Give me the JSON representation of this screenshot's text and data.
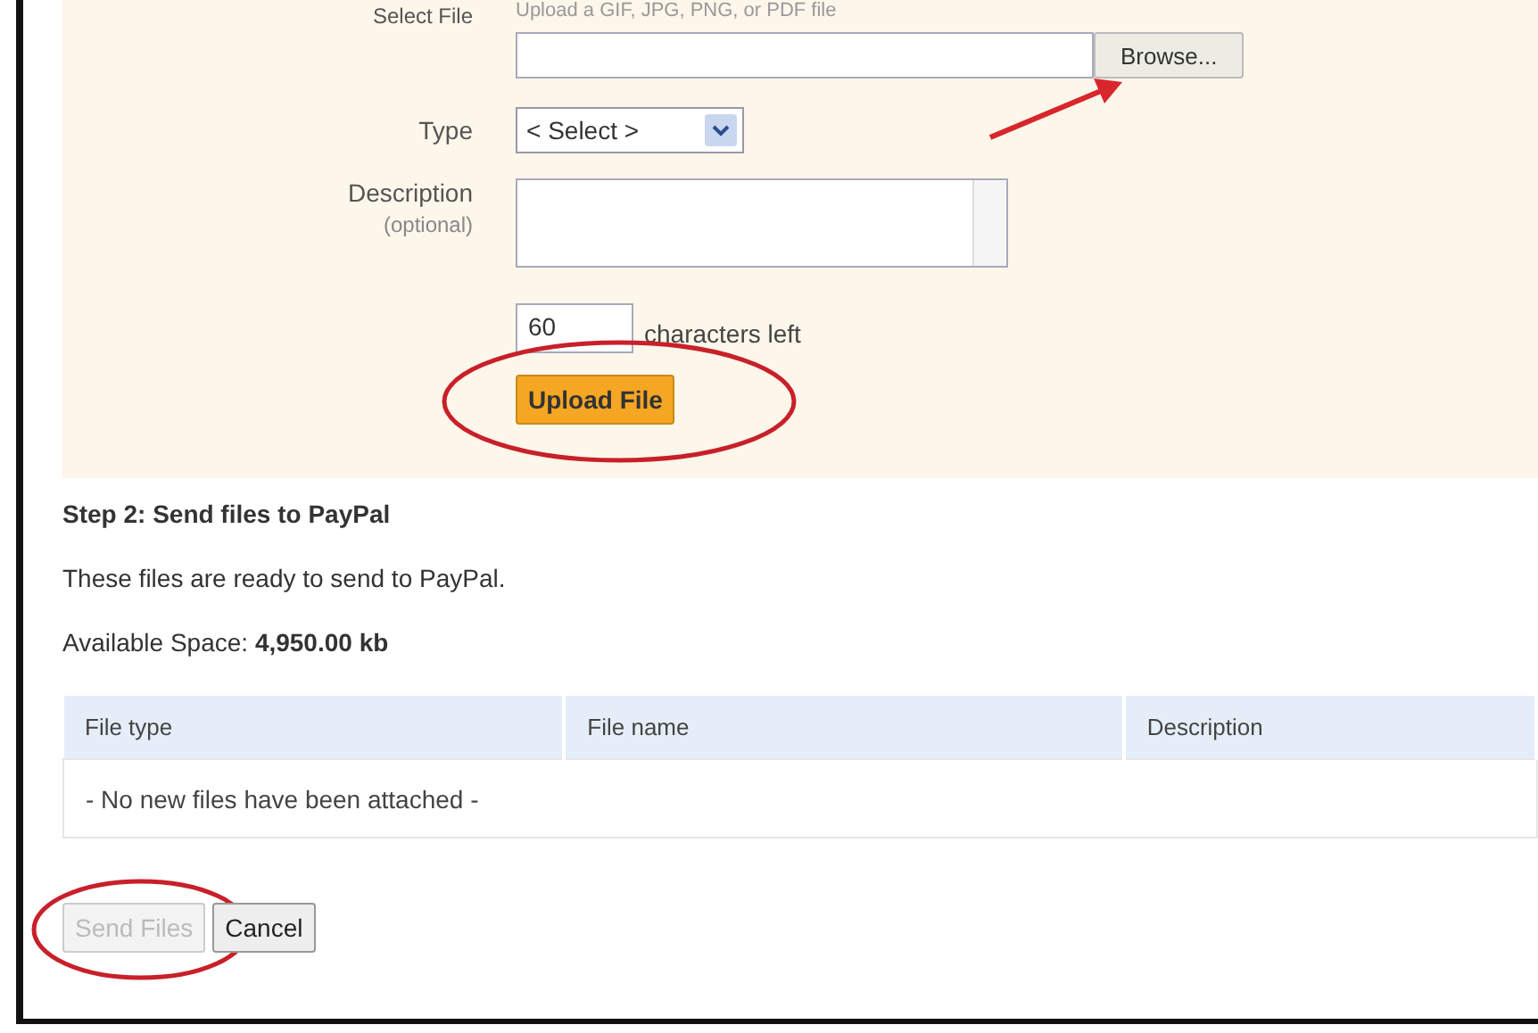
{
  "upload_form": {
    "file_label": "Select File",
    "file_hint": "Upload a GIF, JPG, PNG, or PDF file",
    "browse_button": {
      "label": "Browse...",
      "pointed_at": true
    },
    "type_label": "Type",
    "type_select": {
      "value": "< Select >"
    },
    "description_label": "Description",
    "description_note": "(optional)",
    "char_count": {
      "value": "60",
      "label": "characters left"
    },
    "upload_button": {
      "label": "Upload File",
      "circled": true
    }
  },
  "step2": {
    "heading": "Step 2: Send files to PayPal",
    "message": "These files are ready to send to PayPal.",
    "space": "Available Space: **4,950.00 kb**",
    "table": {
      "columns": [
        "File type",
        "File name",
        "Description"
      ],
      "empty_message": "- No new files have been attached -"
    }
  },
  "buttons": [
    {
      "label": "Send Files",
      "disabled": true,
      "circled": true
    },
    {
      "label": "Cancel",
      "disabled": false,
      "circled": false
    }
  ]
}
